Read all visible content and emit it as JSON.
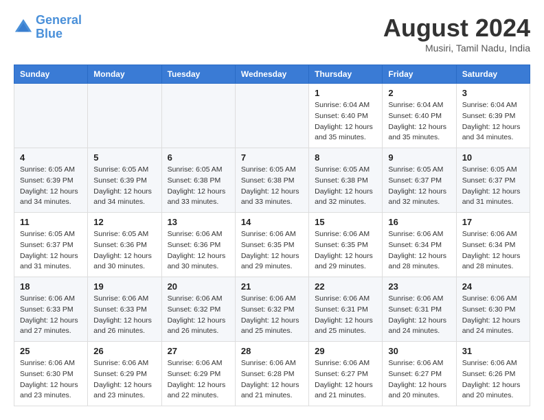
{
  "logo": {
    "line1": "General",
    "line2": "Blue"
  },
  "title": "August 2024",
  "location": "Musiri, Tamil Nadu, India",
  "days_header": [
    "Sunday",
    "Monday",
    "Tuesday",
    "Wednesday",
    "Thursday",
    "Friday",
    "Saturday"
  ],
  "weeks": [
    [
      {
        "day": "",
        "sunrise": "",
        "sunset": "",
        "daylight": ""
      },
      {
        "day": "",
        "sunrise": "",
        "sunset": "",
        "daylight": ""
      },
      {
        "day": "",
        "sunrise": "",
        "sunset": "",
        "daylight": ""
      },
      {
        "day": "",
        "sunrise": "",
        "sunset": "",
        "daylight": ""
      },
      {
        "day": "1",
        "sunrise": "Sunrise: 6:04 AM",
        "sunset": "Sunset: 6:40 PM",
        "daylight": "Daylight: 12 hours and 35 minutes."
      },
      {
        "day": "2",
        "sunrise": "Sunrise: 6:04 AM",
        "sunset": "Sunset: 6:40 PM",
        "daylight": "Daylight: 12 hours and 35 minutes."
      },
      {
        "day": "3",
        "sunrise": "Sunrise: 6:04 AM",
        "sunset": "Sunset: 6:39 PM",
        "daylight": "Daylight: 12 hours and 34 minutes."
      }
    ],
    [
      {
        "day": "4",
        "sunrise": "Sunrise: 6:05 AM",
        "sunset": "Sunset: 6:39 PM",
        "daylight": "Daylight: 12 hours and 34 minutes."
      },
      {
        "day": "5",
        "sunrise": "Sunrise: 6:05 AM",
        "sunset": "Sunset: 6:39 PM",
        "daylight": "Daylight: 12 hours and 34 minutes."
      },
      {
        "day": "6",
        "sunrise": "Sunrise: 6:05 AM",
        "sunset": "Sunset: 6:38 PM",
        "daylight": "Daylight: 12 hours and 33 minutes."
      },
      {
        "day": "7",
        "sunrise": "Sunrise: 6:05 AM",
        "sunset": "Sunset: 6:38 PM",
        "daylight": "Daylight: 12 hours and 33 minutes."
      },
      {
        "day": "8",
        "sunrise": "Sunrise: 6:05 AM",
        "sunset": "Sunset: 6:38 PM",
        "daylight": "Daylight: 12 hours and 32 minutes."
      },
      {
        "day": "9",
        "sunrise": "Sunrise: 6:05 AM",
        "sunset": "Sunset: 6:37 PM",
        "daylight": "Daylight: 12 hours and 32 minutes."
      },
      {
        "day": "10",
        "sunrise": "Sunrise: 6:05 AM",
        "sunset": "Sunset: 6:37 PM",
        "daylight": "Daylight: 12 hours and 31 minutes."
      }
    ],
    [
      {
        "day": "11",
        "sunrise": "Sunrise: 6:05 AM",
        "sunset": "Sunset: 6:37 PM",
        "daylight": "Daylight: 12 hours and 31 minutes."
      },
      {
        "day": "12",
        "sunrise": "Sunrise: 6:05 AM",
        "sunset": "Sunset: 6:36 PM",
        "daylight": "Daylight: 12 hours and 30 minutes."
      },
      {
        "day": "13",
        "sunrise": "Sunrise: 6:06 AM",
        "sunset": "Sunset: 6:36 PM",
        "daylight": "Daylight: 12 hours and 30 minutes."
      },
      {
        "day": "14",
        "sunrise": "Sunrise: 6:06 AM",
        "sunset": "Sunset: 6:35 PM",
        "daylight": "Daylight: 12 hours and 29 minutes."
      },
      {
        "day": "15",
        "sunrise": "Sunrise: 6:06 AM",
        "sunset": "Sunset: 6:35 PM",
        "daylight": "Daylight: 12 hours and 29 minutes."
      },
      {
        "day": "16",
        "sunrise": "Sunrise: 6:06 AM",
        "sunset": "Sunset: 6:34 PM",
        "daylight": "Daylight: 12 hours and 28 minutes."
      },
      {
        "day": "17",
        "sunrise": "Sunrise: 6:06 AM",
        "sunset": "Sunset: 6:34 PM",
        "daylight": "Daylight: 12 hours and 28 minutes."
      }
    ],
    [
      {
        "day": "18",
        "sunrise": "Sunrise: 6:06 AM",
        "sunset": "Sunset: 6:33 PM",
        "daylight": "Daylight: 12 hours and 27 minutes."
      },
      {
        "day": "19",
        "sunrise": "Sunrise: 6:06 AM",
        "sunset": "Sunset: 6:33 PM",
        "daylight": "Daylight: 12 hours and 26 minutes."
      },
      {
        "day": "20",
        "sunrise": "Sunrise: 6:06 AM",
        "sunset": "Sunset: 6:32 PM",
        "daylight": "Daylight: 12 hours and 26 minutes."
      },
      {
        "day": "21",
        "sunrise": "Sunrise: 6:06 AM",
        "sunset": "Sunset: 6:32 PM",
        "daylight": "Daylight: 12 hours and 25 minutes."
      },
      {
        "day": "22",
        "sunrise": "Sunrise: 6:06 AM",
        "sunset": "Sunset: 6:31 PM",
        "daylight": "Daylight: 12 hours and 25 minutes."
      },
      {
        "day": "23",
        "sunrise": "Sunrise: 6:06 AM",
        "sunset": "Sunset: 6:31 PM",
        "daylight": "Daylight: 12 hours and 24 minutes."
      },
      {
        "day": "24",
        "sunrise": "Sunrise: 6:06 AM",
        "sunset": "Sunset: 6:30 PM",
        "daylight": "Daylight: 12 hours and 24 minutes."
      }
    ],
    [
      {
        "day": "25",
        "sunrise": "Sunrise: 6:06 AM",
        "sunset": "Sunset: 6:30 PM",
        "daylight": "Daylight: 12 hours and 23 minutes."
      },
      {
        "day": "26",
        "sunrise": "Sunrise: 6:06 AM",
        "sunset": "Sunset: 6:29 PM",
        "daylight": "Daylight: 12 hours and 23 minutes."
      },
      {
        "day": "27",
        "sunrise": "Sunrise: 6:06 AM",
        "sunset": "Sunset: 6:29 PM",
        "daylight": "Daylight: 12 hours and 22 minutes."
      },
      {
        "day": "28",
        "sunrise": "Sunrise: 6:06 AM",
        "sunset": "Sunset: 6:28 PM",
        "daylight": "Daylight: 12 hours and 21 minutes."
      },
      {
        "day": "29",
        "sunrise": "Sunrise: 6:06 AM",
        "sunset": "Sunset: 6:27 PM",
        "daylight": "Daylight: 12 hours and 21 minutes."
      },
      {
        "day": "30",
        "sunrise": "Sunrise: 6:06 AM",
        "sunset": "Sunset: 6:27 PM",
        "daylight": "Daylight: 12 hours and 20 minutes."
      },
      {
        "day": "31",
        "sunrise": "Sunrise: 6:06 AM",
        "sunset": "Sunset: 6:26 PM",
        "daylight": "Daylight: 12 hours and 20 minutes."
      }
    ]
  ]
}
